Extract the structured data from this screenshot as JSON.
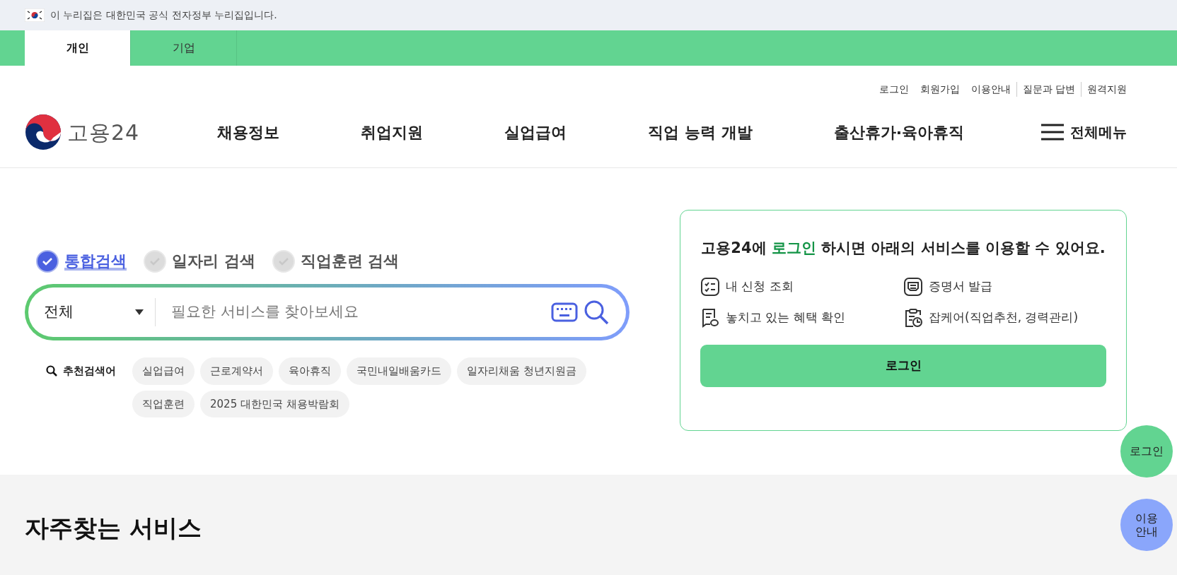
{
  "notice": {
    "text": "이 누리집은 대한민국 공식 전자정부 누리집입니다."
  },
  "user_tabs": [
    {
      "label": "개인",
      "selected": true
    },
    {
      "label": "기업",
      "selected": false
    }
  ],
  "utility_links": [
    {
      "label": "로그인",
      "separated": false
    },
    {
      "label": "회원가입",
      "separated": false
    },
    {
      "label": "이용안내",
      "separated": false
    },
    {
      "label": "질문과 답변",
      "separated": true
    },
    {
      "label": "원격지원",
      "separated": true
    }
  ],
  "logo": {
    "text": "고용24"
  },
  "nav": [
    "채용정보",
    "취업지원",
    "실업급여",
    "직업 능력 개발",
    "출산휴가·육아휴직"
  ],
  "all_menu": {
    "label": "전체메뉴"
  },
  "search_tabs": [
    {
      "label": "통합검색",
      "selected": true
    },
    {
      "label": "일자리 검색",
      "selected": false
    },
    {
      "label": "직업훈련 검색",
      "selected": false
    }
  ],
  "search": {
    "category": "전체",
    "placeholder": "필요한 서비스를 찾아보세요"
  },
  "recommended": {
    "label": "추천검색어",
    "keywords": [
      "실업급여",
      "근로계약서",
      "육아휴직",
      "국민내일배움카드",
      "일자리채움 청년지원금",
      "직업훈련",
      "2025 대한민국 채용박람회"
    ]
  },
  "login_card": {
    "title_before": "고용24에",
    "title_highlight": "로그인",
    "title_after": "하시면 아래의 서비스를 이용할 수 있어요.",
    "services": [
      {
        "kind": "checklist",
        "label": "내 신청 조회"
      },
      {
        "kind": "certificate",
        "label": "증명서 발급"
      },
      {
        "kind": "document",
        "label": "놓치고 있는 혜택 확인"
      },
      {
        "kind": "clipboard",
        "label": "잡케어(직업추천, 경력관리)"
      }
    ],
    "button": "로그인"
  },
  "section": {
    "heading": "자주찾는 서비스"
  },
  "floating_buttons": [
    {
      "label": "로그인",
      "color": "#62d491"
    },
    {
      "label": "이용 안내",
      "color": "#8aa6fb"
    }
  ]
}
